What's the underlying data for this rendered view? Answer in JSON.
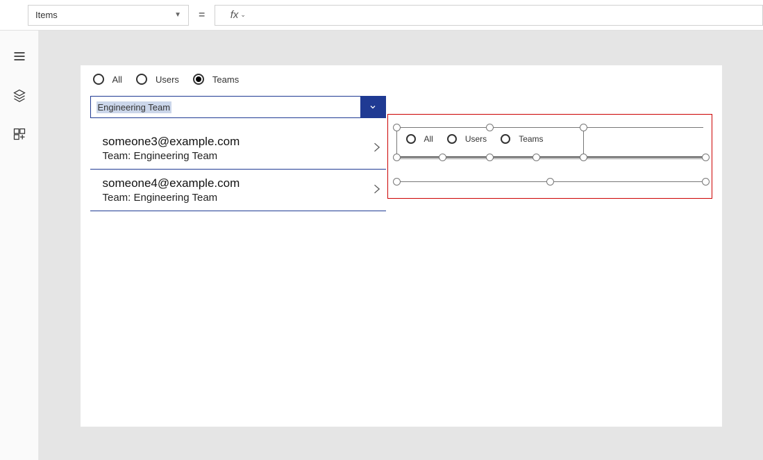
{
  "formula_bar": {
    "property": "Items",
    "equals": "=",
    "fx_label": "fx"
  },
  "canvas": {
    "radios": {
      "opt1": "All",
      "opt2": "Users",
      "opt3": "Teams"
    },
    "dropdown": {
      "value": "Engineering Team"
    },
    "list": [
      {
        "title": "someone3@example.com",
        "sub": "Team: Engineering Team"
      },
      {
        "title": "someone4@example.com",
        "sub": "Team: Engineering Team"
      }
    ],
    "selected_control": {
      "radios": {
        "opt1": "All",
        "opt2": "Users",
        "opt3": "Teams"
      }
    }
  }
}
